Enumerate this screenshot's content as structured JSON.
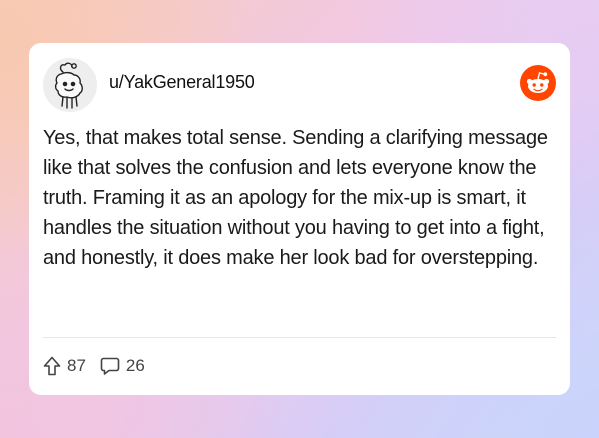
{
  "post": {
    "username": "u/YakGeneral1950",
    "body": "Yes, that makes total sense. Sending a clarifying message like that solves the confusion and lets everyone know the truth. Framing it as an apology for the mix-up is smart, it handles the situation without you having to get into a fight, and honestly, it does make her look bad for overstepping.",
    "upvotes": "87",
    "comments": "26"
  },
  "icons": {
    "avatar": "snoo-avatar-icon",
    "brand": "reddit-logo-icon",
    "upvote": "upvote-arrow-icon",
    "comment": "comment-bubble-icon"
  },
  "colors": {
    "brand": "#ff4500",
    "text": "#1a1a1a",
    "muted": "#444444",
    "card": "#ffffff"
  }
}
